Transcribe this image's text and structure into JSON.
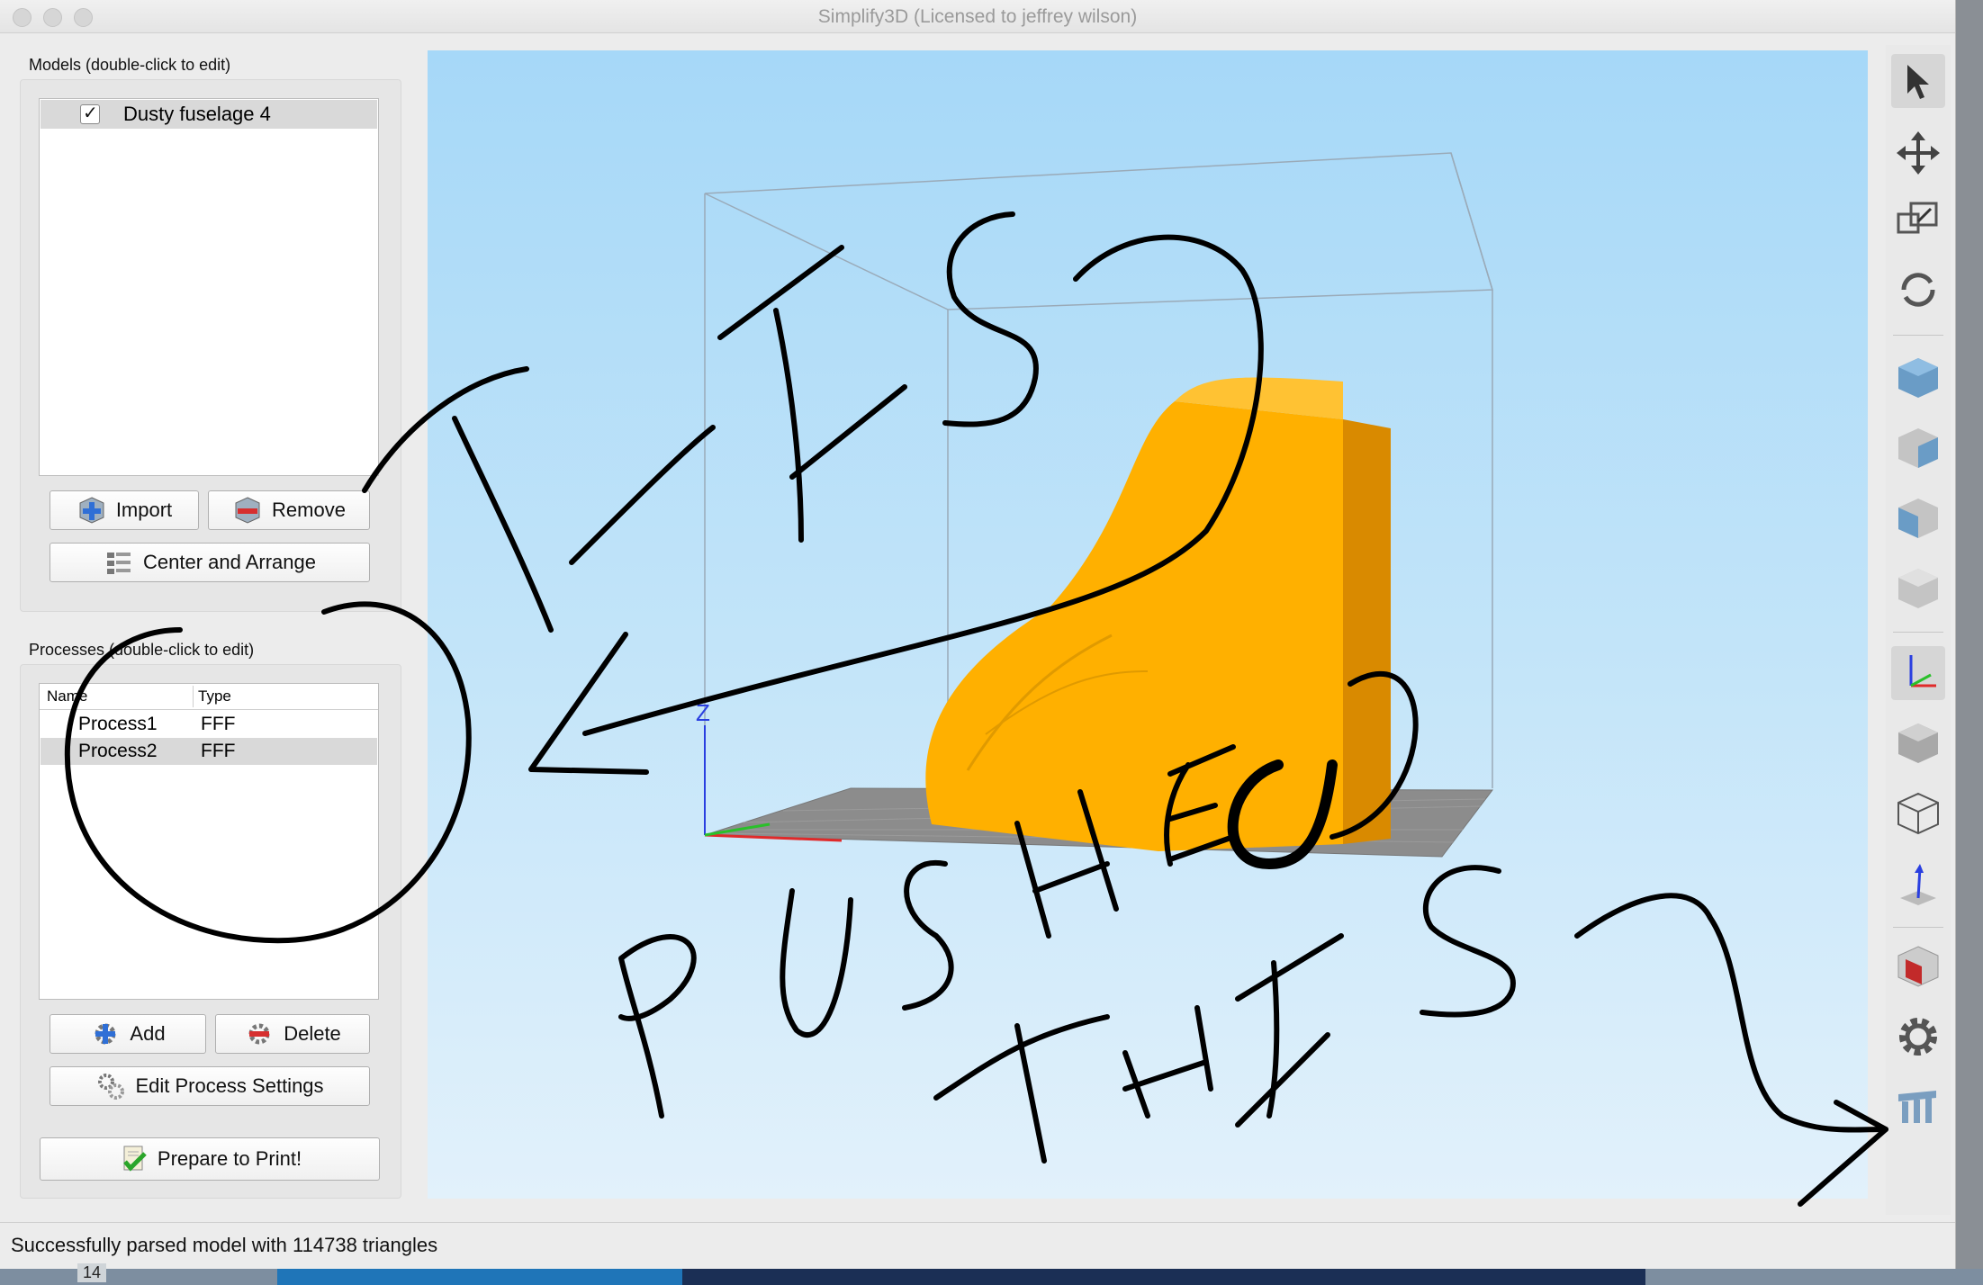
{
  "window": {
    "title": "Simplify3D (Licensed to jeffrey wilson)"
  },
  "models": {
    "label": "Models (double-click to edit)",
    "items": [
      {
        "name": "Dusty fuselage 4",
        "checked": true
      }
    ],
    "import_label": "Import",
    "remove_label": "Remove",
    "center_label": "Center and Arrange"
  },
  "processes": {
    "label": "Processes (double-click to edit)",
    "columns": [
      "Name",
      "Type"
    ],
    "rows": [
      {
        "name": "Process1",
        "type": "FFF"
      },
      {
        "name": "Process2",
        "type": "FFF"
      }
    ],
    "add_label": "Add",
    "delete_label": "Delete",
    "edit_label": "Edit Process Settings"
  },
  "prepare_label": "Prepare to Print!",
  "viewport": {
    "axis_label": "Z"
  },
  "status": {
    "text": "Successfully parsed model with 114738 triangles"
  },
  "taskbar": {
    "badge": "14"
  },
  "annotations": {
    "top_text": "THIS?",
    "bottom_text": "PUSHED THIS?",
    "ink_color": "#000000"
  },
  "toolbar_icons": [
    "select-arrow-icon",
    "move-icon",
    "scale-icon",
    "rotate-icon",
    "view-cube-default-icon",
    "view-cube-front-icon",
    "view-cube-side-icon",
    "view-cube-top-icon",
    "axes-icon",
    "solid-view-icon",
    "wireframe-icon",
    "normal-arrow-icon",
    "cross-section-icon",
    "settings-gear-icon",
    "support-icon"
  ],
  "colors": {
    "model": "#ffb000",
    "viewport_top": "#a6d8f8",
    "bed": "#8a8a8a"
  }
}
